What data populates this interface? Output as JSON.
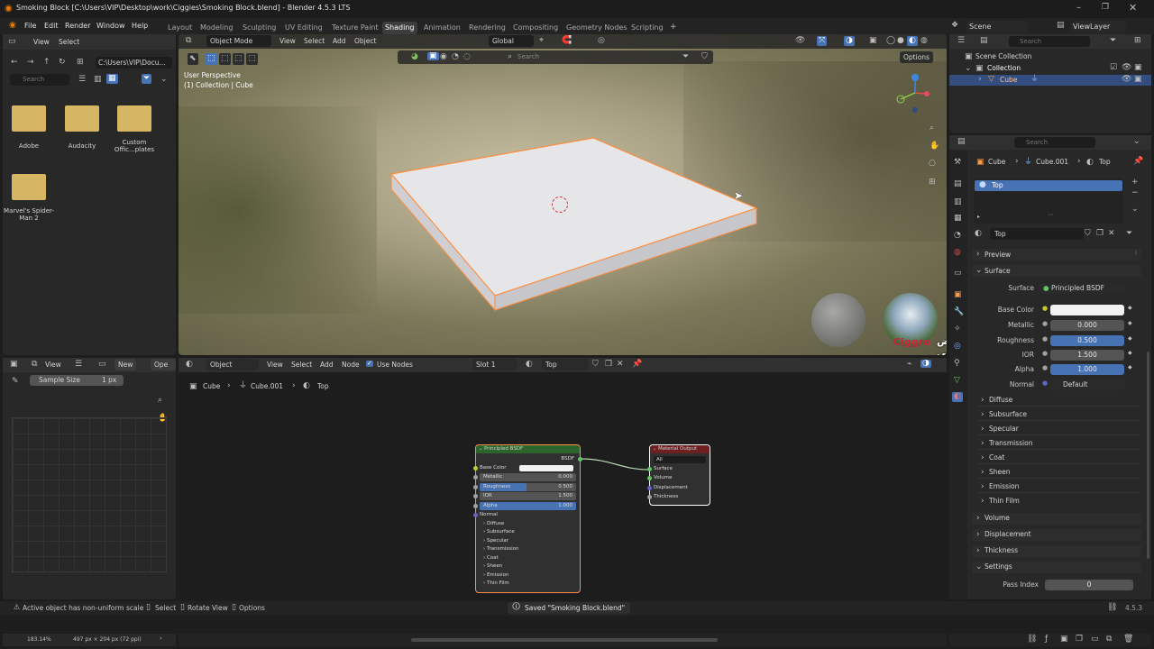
{
  "window": {
    "title": "Smoking Block [C:\\Users\\VIP\\Desktop\\work\\Ciggies\\Smoking Block.blend] - Blender 4.5.3 LTS"
  },
  "menu": [
    "File",
    "Edit",
    "Render",
    "Window",
    "Help"
  ],
  "workspaces": [
    "Layout",
    "Modeling",
    "Sculpting",
    "UV Editing",
    "Texture Paint",
    "Shading",
    "Animation",
    "Rendering",
    "Compositing",
    "Geometry Nodes",
    "Scripting"
  ],
  "active_workspace": "Shading",
  "scene": {
    "name": "Scene",
    "view_layer": "ViewLayer"
  },
  "file_browser": {
    "menu": [
      "View",
      "Select"
    ],
    "path": "C:\\Users\\VIP\\Docu...",
    "search_placeholder": "Search",
    "folders": [
      "Adobe",
      "Audacity",
      "Custom Offic...plates",
      "Marvel's Spider-Man 2"
    ]
  },
  "viewport": {
    "mode": "Object Mode",
    "menu": [
      "View",
      "Select",
      "Add",
      "Object"
    ],
    "transform": "Global",
    "search_placeholder": "Search",
    "options_label": "Options",
    "info_line1": "User Perspective",
    "info_line2": "(1) Collection | Cube"
  },
  "image_editor": {
    "view_label": "View",
    "new_label": "New",
    "open_label": "Ope",
    "sample_size_label": "Sample Size",
    "sample_size_value": "1 px"
  },
  "node_editor": {
    "object_label": "Object",
    "menu": [
      "View",
      "Select",
      "Add",
      "Node"
    ],
    "use_nodes_label": "Use Nodes",
    "slot_label": "Slot 1",
    "material_name": "Top",
    "breadcrumb": [
      "Cube",
      "Cube.001",
      "Top"
    ],
    "bsdf_node": {
      "title": "Principled BSDF",
      "output": "BSDF",
      "rows": [
        {
          "label": "Base Color",
          "value": ""
        },
        {
          "label": "Metallic",
          "value": "0.000"
        },
        {
          "label": "Roughness",
          "value": "0.500"
        },
        {
          "label": "IOR",
          "value": "1.500"
        },
        {
          "label": "Alpha",
          "value": "1.000"
        }
      ],
      "normal_label": "Normal",
      "sub_panels": [
        "Diffuse",
        "Subsurface",
        "Specular",
        "Transmission",
        "Coat",
        "Sheen",
        "Emission",
        "Thin Film"
      ]
    },
    "output_node": {
      "title": "Material Output",
      "target": "All",
      "inputs": [
        "Surface",
        "Volume",
        "Displacement",
        "Thickness"
      ]
    }
  },
  "outliner": {
    "search_placeholder": "Search",
    "scene_collection": "Scene Collection",
    "collection": "Collection",
    "object": "Cube"
  },
  "properties": {
    "search_placeholder": "Search",
    "breadcrumb": [
      "Cube",
      "Cube.001",
      "Top"
    ],
    "slot_name": "Top",
    "material_name": "Top",
    "panels": {
      "preview": "Preview",
      "surface": "Surface",
      "volume": "Volume",
      "displacement": "Displacement",
      "thickness": "Thickness",
      "settings": "Settings"
    },
    "surface_label": "Surface",
    "surface_value": "Principled BSDF",
    "fields": [
      {
        "label": "Base Color",
        "value": ""
      },
      {
        "label": "Metallic",
        "value": "0.000"
      },
      {
        "label": "Roughness",
        "value": "0.500"
      },
      {
        "label": "IOR",
        "value": "1.500"
      },
      {
        "label": "Alpha",
        "value": "1.000"
      },
      {
        "label": "Normal",
        "value": "Default"
      }
    ],
    "sub_panels": [
      "Diffuse",
      "Subsurface",
      "Specular",
      "Transmission",
      "Coat",
      "Sheen",
      "Emission",
      "Thin Film"
    ],
    "pass_index_label": "Pass Index",
    "pass_index_value": "0"
  },
  "watermark": "Ciggro",
  "overlay_caption": "التقروض تعرفني",
  "status": {
    "hint": "Active object has non-uniform scale",
    "select": "Select",
    "rotate": "Rotate View",
    "options": "Options",
    "saved": "Saved \"Smoking Block.blend\"",
    "version": "4.5.3",
    "zoom": "183.14%",
    "dims": "497 px × 204 px (72 ppi)"
  },
  "colors": {
    "accent": "#4772b3",
    "selection": "#ff8c4a",
    "bsdf_header": "#2b652b",
    "output_header": "#6e1f1f"
  }
}
